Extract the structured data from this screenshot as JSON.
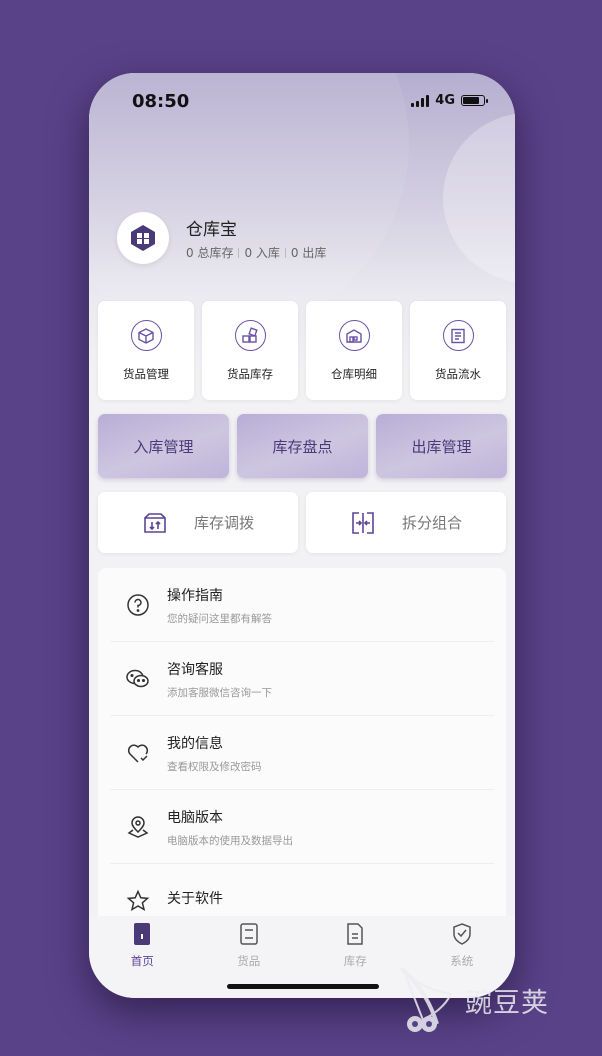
{
  "status_bar": {
    "time": "08:50",
    "network": "4G"
  },
  "profile": {
    "app_name": "仓库宝",
    "stats": [
      "0 总库存",
      "0 入库",
      "0 出库"
    ]
  },
  "quick_cards": [
    {
      "label": "货品管理",
      "icon": "box-icon"
    },
    {
      "label": "货品库存",
      "icon": "blocks-icon"
    },
    {
      "label": "仓库明细",
      "icon": "warehouse-icon"
    },
    {
      "label": "货品流水",
      "icon": "ledger-icon"
    }
  ],
  "primary_actions": [
    "入库管理",
    "库存盘点",
    "出库管理"
  ],
  "secondary_actions": [
    {
      "label": "库存调拨",
      "icon": "transfer-box-icon"
    },
    {
      "label": "拆分组合",
      "icon": "split-merge-icon"
    }
  ],
  "menu": [
    {
      "title": "操作指南",
      "subtitle": "您的疑问这里都有解答",
      "icon": "question-icon"
    },
    {
      "title": "咨询客服",
      "subtitle": "添加客服微信咨询一下",
      "icon": "wechat-icon"
    },
    {
      "title": "我的信息",
      "subtitle": "查看权限及修改密码",
      "icon": "heart-check-icon"
    },
    {
      "title": "电脑版本",
      "subtitle": "电脑版本的使用及数据导出",
      "icon": "location-icon"
    },
    {
      "title": "关于软件",
      "subtitle": "",
      "icon": "star-icon"
    }
  ],
  "tabs": [
    {
      "label": "首页",
      "icon": "home-icon",
      "active": true
    },
    {
      "label": "货品",
      "icon": "goods-icon",
      "active": false
    },
    {
      "label": "库存",
      "icon": "stock-icon",
      "active": false
    },
    {
      "label": "系统",
      "icon": "shield-icon",
      "active": false
    }
  ],
  "watermark": {
    "text": "豌豆荚"
  },
  "colors": {
    "background": "#5a4288",
    "accent": "#5b4597",
    "icon_stroke": "#6a52a6"
  }
}
